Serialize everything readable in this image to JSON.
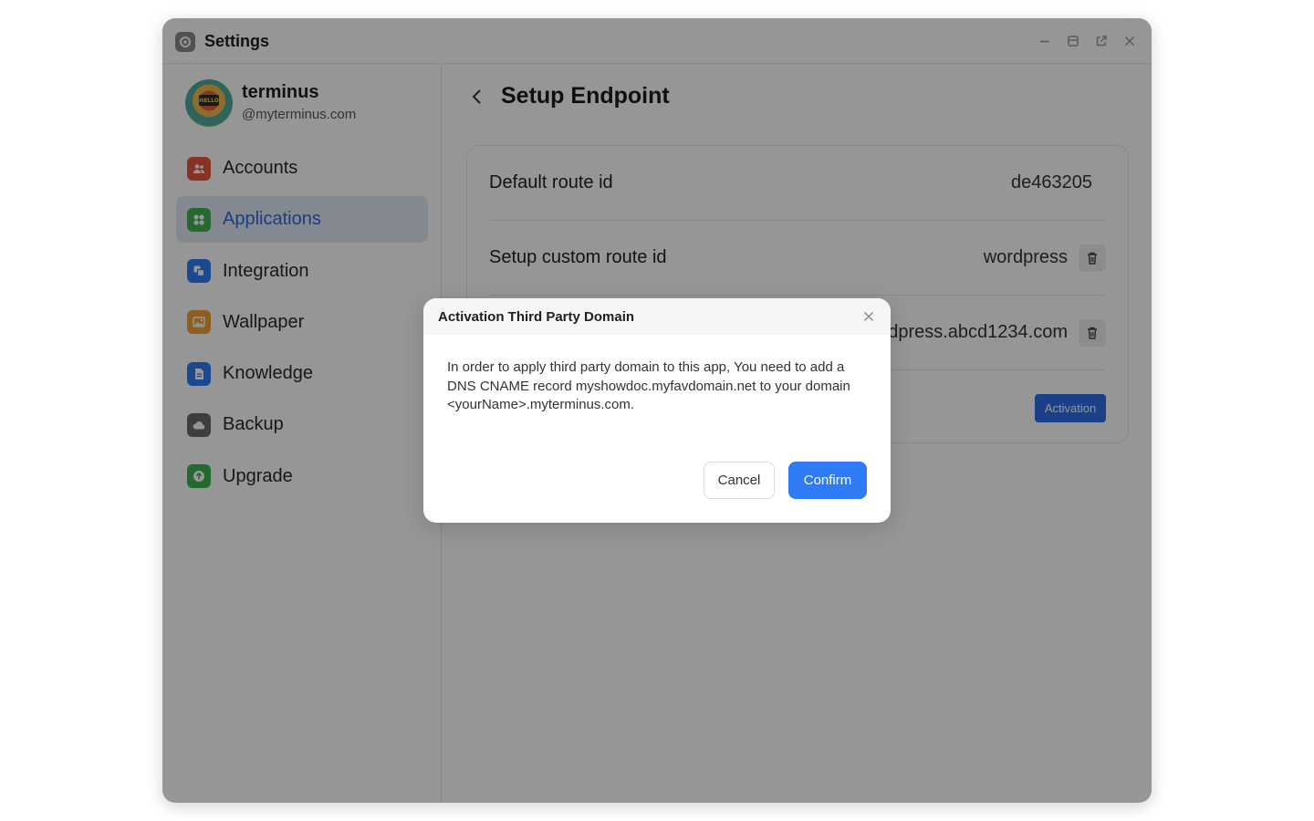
{
  "window": {
    "title": "Settings",
    "icons": {
      "app": "gear-icon",
      "minimize": "minimize-icon",
      "maximize": "maximize-icon",
      "popout": "external-window-icon",
      "close": "close-icon"
    }
  },
  "profile": {
    "name": "terminus",
    "handle": "@myterminus.com",
    "avatar_sign": "HELLO"
  },
  "sidebar": {
    "items": [
      {
        "label": "Accounts",
        "icon": "accounts-icon",
        "color": "#e5553f",
        "active": false
      },
      {
        "label": "Applications",
        "icon": "applications-icon",
        "color": "#3fb34f",
        "active": true
      },
      {
        "label": "Integration",
        "icon": "integration-icon",
        "color": "#2f7bf6",
        "active": false
      },
      {
        "label": "Wallpaper",
        "icon": "wallpaper-icon",
        "color": "#f0a030",
        "active": false
      },
      {
        "label": "Knowledge",
        "icon": "knowledge-icon",
        "color": "#2f7bf6",
        "active": false
      },
      {
        "label": "Backup",
        "icon": "backup-icon",
        "color": "#6a6a6a",
        "active": false
      },
      {
        "label": "Upgrade",
        "icon": "upgrade-icon",
        "color": "#3fb34f",
        "active": false
      }
    ],
    "active_color": "#2d6bdb"
  },
  "main": {
    "title": "Setup Endpoint",
    "rows": [
      {
        "label": "Default route id",
        "value": "de463205"
      },
      {
        "label": "Setup custom route id",
        "value": "wordpress"
      },
      {
        "label": "",
        "value": "wordpress.abcd1234.com"
      },
      {
        "label": "",
        "button": "Activation"
      }
    ]
  },
  "dialog": {
    "title": "Activation Third Party Domain",
    "body": "In order to apply third party domain to this app, You need to add a DNS CNAME record myshowdoc.myfavdomain.net to your domain <yourName>.myterminus.com.",
    "cancel": "Cancel",
    "confirm": "Confirm",
    "accent": "#2f7bf6"
  }
}
